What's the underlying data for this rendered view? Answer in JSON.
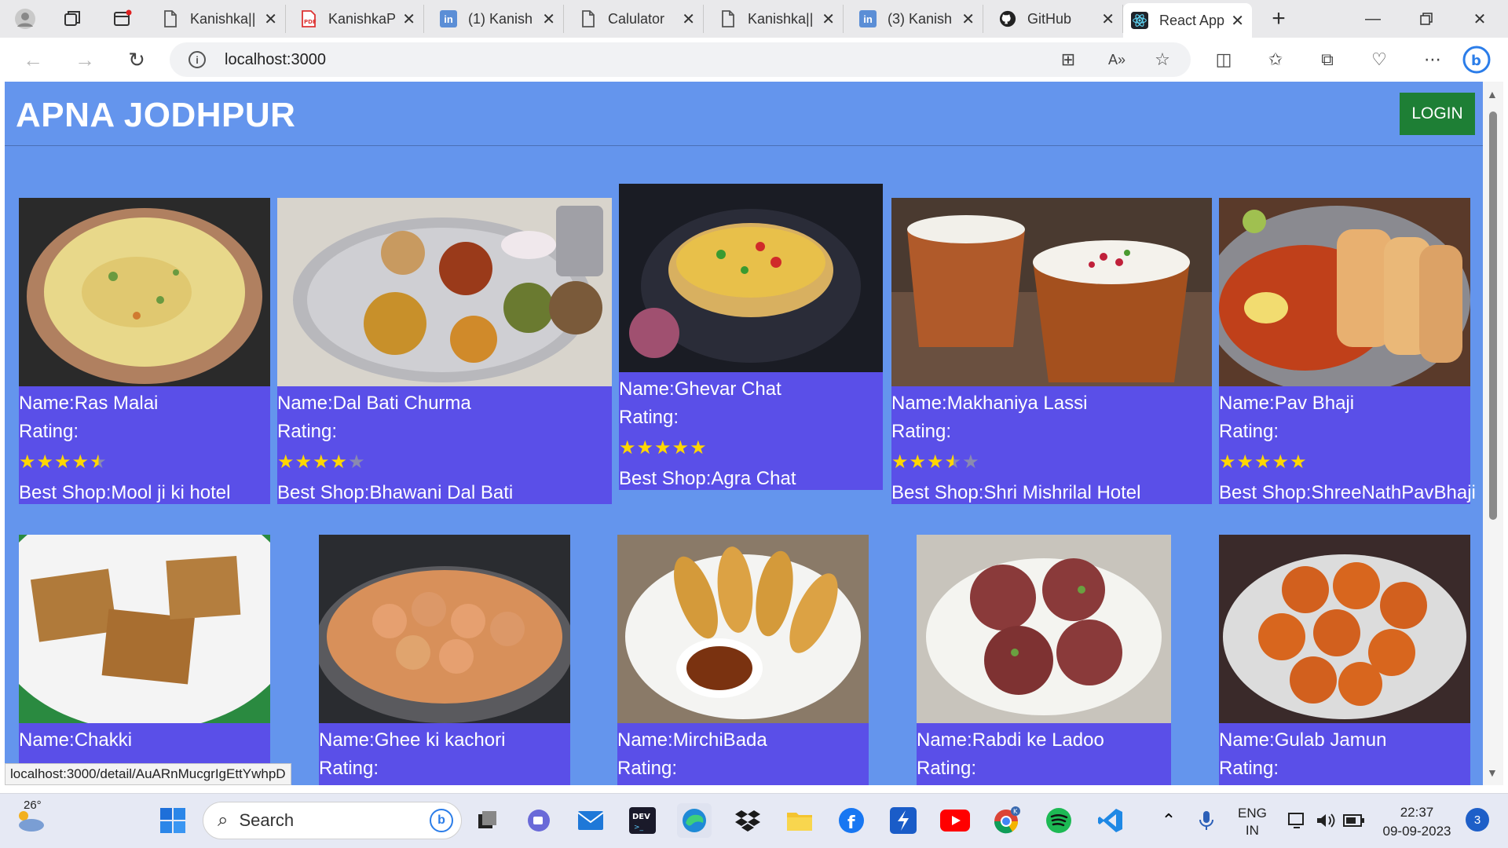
{
  "browser": {
    "tabs": [
      {
        "title": "Kanishka||",
        "icon": "document-icon"
      },
      {
        "title": "KanishkaP",
        "icon": "pdf-icon"
      },
      {
        "title": "(1) Kanish",
        "icon": "linkedin-icon"
      },
      {
        "title": "Calulator",
        "icon": "document-icon"
      },
      {
        "title": "Kanishka||",
        "icon": "document-icon"
      },
      {
        "title": "(3) Kanish",
        "icon": "linkedin-icon"
      },
      {
        "title": "GitHub",
        "icon": "github-icon"
      },
      {
        "title": "React App",
        "icon": "react-icon"
      }
    ],
    "address": "localhost:3000"
  },
  "page": {
    "brand": "APNA JODHPUR",
    "login_label": "LOGIN",
    "labels": {
      "name": "Name:",
      "rating": "Rating:",
      "best_shop": "Best Shop:"
    },
    "cards": [
      {
        "name": "Ras Malai",
        "rating": 4.5,
        "shop": "Mool ji ki hotel"
      },
      {
        "name": "Dal Bati Churma",
        "rating": 4,
        "shop": "Bhawani Dal Bati"
      },
      {
        "name": "Ghevar Chat",
        "rating": 5,
        "shop": "Agra Chat"
      },
      {
        "name": "Makhaniya Lassi",
        "rating": 3.5,
        "shop": "Shri Mishrilal Hotel"
      },
      {
        "name": "Pav Bhaji",
        "rating": 5,
        "shop": "ShreeNathPavBhaji"
      },
      {
        "name": "Chakki"
      },
      {
        "name": "Ghee ki kachori"
      },
      {
        "name": "MirchiBada"
      },
      {
        "name": "Rabdi ke Ladoo"
      },
      {
        "name": "Gulab Jamun"
      }
    ],
    "status_url": "localhost:3000/detail/AuARnMucgrIgEttYwhpD"
  },
  "taskbar": {
    "weather_temp": "26°",
    "search_placeholder": "Search",
    "lang_line1": "ENG",
    "lang_line2": "IN",
    "time": "22:37",
    "date": "09-09-2023",
    "notification_count": "3"
  }
}
